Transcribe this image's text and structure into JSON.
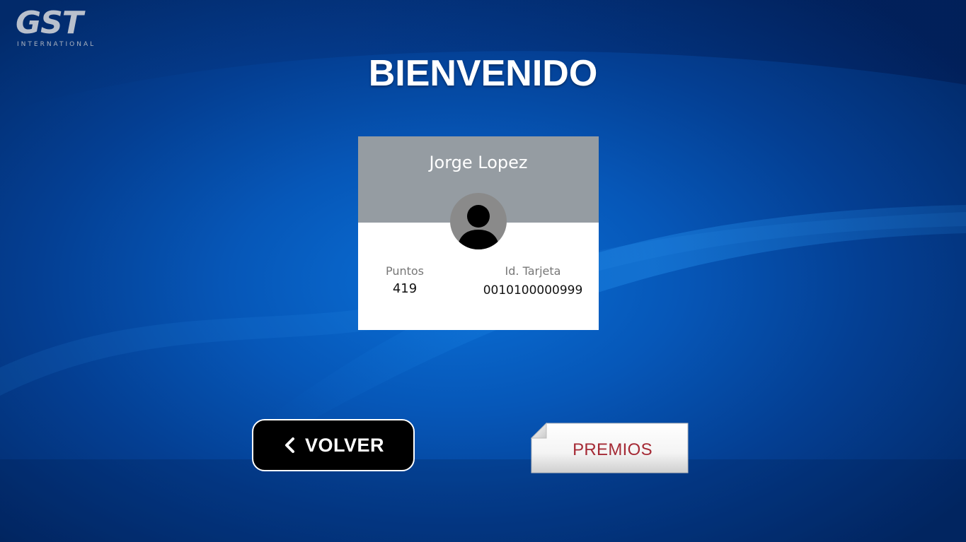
{
  "brand": {
    "logo_main": "GST",
    "logo_sub": "INTERNATIONAL"
  },
  "page": {
    "title": "BIENVENIDO"
  },
  "member_card": {
    "name": "Jorge Lopez",
    "points_label": "Puntos",
    "points_value": "419",
    "card_id_label": "Id. Tarjeta",
    "card_id_value": "0010100000999",
    "avatar_icon": "user-silhouette-icon"
  },
  "actions": {
    "back_label": "VOLVER",
    "back_icon": "chevron-left-icon",
    "prizes_label": "PREMIOS"
  },
  "colors": {
    "background": "#0657b8",
    "card_header": "#959ca2",
    "back_button": "#000000",
    "prizes_text": "#a52a35"
  }
}
